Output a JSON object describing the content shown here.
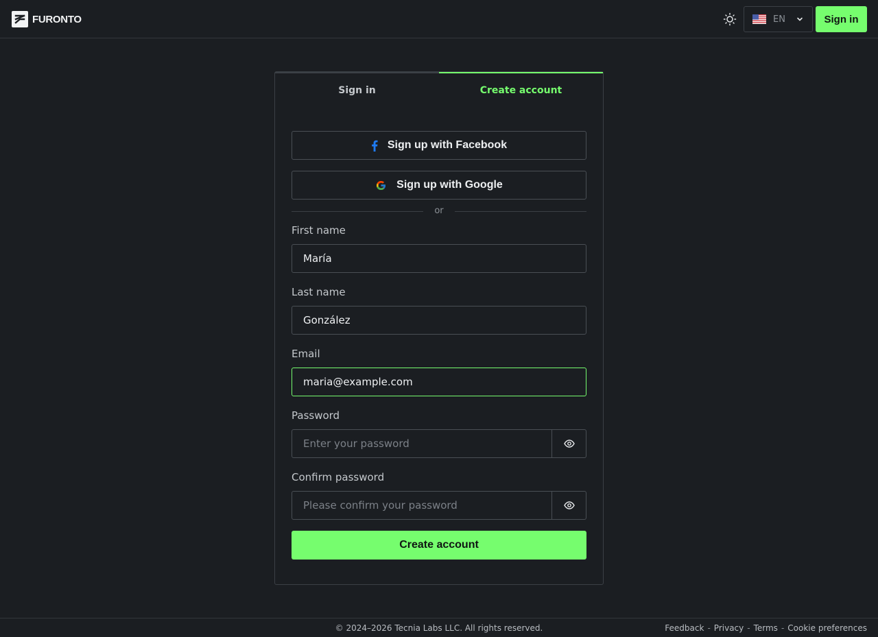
{
  "header": {
    "logo_text": "FURONTO",
    "language": {
      "code": "EN",
      "flag": "us-flag-icon"
    },
    "theme_icon": "sun-icon",
    "signin_label": "Sign in"
  },
  "auth": {
    "tabs": [
      {
        "label": "Sign in",
        "active": false
      },
      {
        "label": "Create account",
        "active": true
      }
    ],
    "facebook_label": "Sign up with Facebook",
    "google_label": "Sign up with Google",
    "divider_text": "or",
    "fields": {
      "first_name": {
        "label": "First name",
        "value": "María"
      },
      "last_name": {
        "label": "Last name",
        "value": "González"
      },
      "email": {
        "label": "Email",
        "value": "maria@example.com"
      },
      "password": {
        "label": "Password",
        "value": "",
        "placeholder": "Enter your password"
      },
      "confirm": {
        "label": "Confirm password",
        "value": "",
        "placeholder": "Please confirm your password"
      }
    },
    "submit_label": "Create account"
  },
  "footer": {
    "copyright": "© 2024–2026 Tecnia Labs LLC. All rights reserved.",
    "links": [
      "Feedback",
      "Privacy",
      "Terms",
      "Cookie preferences"
    ],
    "separator": "-"
  },
  "colors": {
    "accent": "#76fd6e",
    "background": "#1b1e22",
    "border": "#4a4f55"
  }
}
